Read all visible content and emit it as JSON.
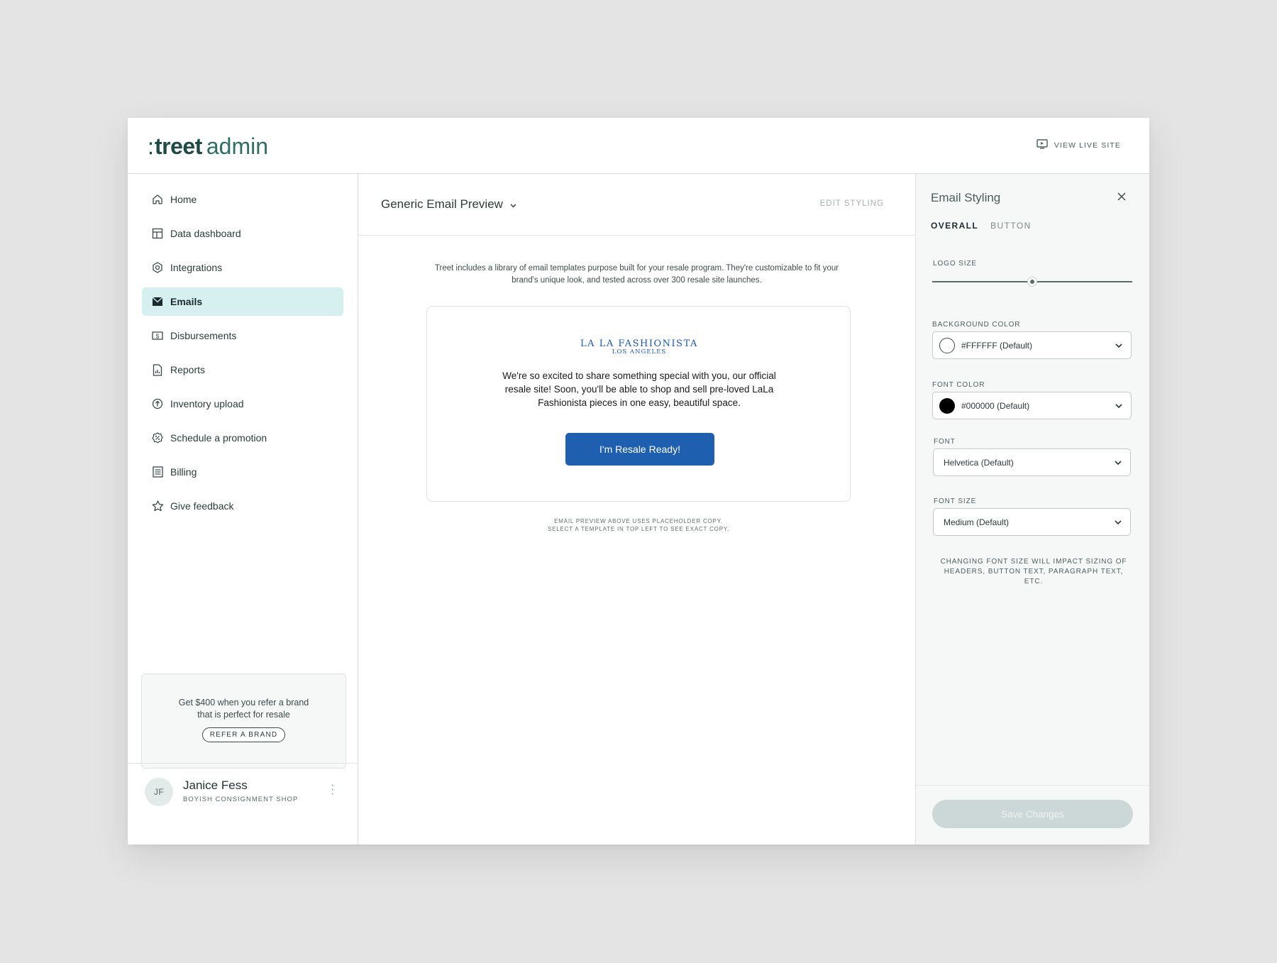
{
  "header": {
    "logo_brand": "treet",
    "logo_suffix": "admin",
    "view_live_label": "VIEW LIVE SITE"
  },
  "sidebar": {
    "items": [
      {
        "label": "Home",
        "icon": "home-icon",
        "active": false
      },
      {
        "label": "Data dashboard",
        "icon": "dashboard-icon",
        "active": false
      },
      {
        "label": "Integrations",
        "icon": "integrations-icon",
        "active": false
      },
      {
        "label": "Emails",
        "icon": "envelope-icon",
        "active": true
      },
      {
        "label": "Disbursements",
        "icon": "dollar-icon",
        "active": false
      },
      {
        "label": "Reports",
        "icon": "report-icon",
        "active": false
      },
      {
        "label": "Inventory upload",
        "icon": "upload-icon",
        "active": false
      },
      {
        "label": "Schedule a promotion",
        "icon": "percent-badge-icon",
        "active": false
      },
      {
        "label": "Billing",
        "icon": "billing-icon",
        "active": false
      },
      {
        "label": "Give feedback",
        "icon": "star-icon",
        "active": false
      }
    ],
    "refer": {
      "text": "Get $400 when you refer a brand that is perfect for resale",
      "button": "REFER A BRAND"
    },
    "user": {
      "initials": "JF",
      "name": "Janice Fess",
      "shop": "BOYISH CONSIGNMENT SHOP"
    }
  },
  "main": {
    "preview_title": "Generic Email Preview",
    "edit_styling": "EDIT STYLING",
    "intro": "Treet includes a library of email templates purpose built for your resale program. They're customizable to fit your brand's unique look, and tested across over 300 resale site launches.",
    "email": {
      "brand_name": "LA LA FASHIONISTA",
      "brand_city": "LOS ANGELES",
      "body": "We're so excited to share something special with you, our official resale site! Soon, you'll be able to shop and sell pre-loved LaLa Fashionista pieces in one easy, beautiful space.",
      "cta": "I'm Resale Ready!"
    },
    "disclaimer_line1": "EMAIL PREVIEW ABOVE USES PLACEHOLDER COPY.",
    "disclaimer_line2": "SELECT A TEMPLATE IN TOP LEFT TO SEE EXACT COPY."
  },
  "panel": {
    "title": "Email Styling",
    "tabs": [
      "OVERALL",
      "BUTTON"
    ],
    "active_tab": "OVERALL",
    "logo_size_label": "LOGO SIZE",
    "logo_size_value": 0.5,
    "background_color_label": "BACKGROUND COLOR",
    "background_color_value": "#FFFFFF (Default)",
    "background_swatch": "#ffffff",
    "font_color_label": "FONT COLOR",
    "font_color_value": "#000000 (Default)",
    "font_swatch": "#000000",
    "font_label": "FONT",
    "font_value": "Helvetica (Default)",
    "font_size_label": "FONT SIZE",
    "font_size_value": "Medium (Default)",
    "note": "CHANGING FONT SIZE WILL IMPACT SIZING OF HEADERS, BUTTON TEXT, PARAGRAPH TEXT, ETC.",
    "save_label": "Save Changes"
  },
  "colors": {
    "accent_active_nav": "#d5f0ef",
    "brand_blue": "#1f5fb0",
    "logo_green": "#1f4a45"
  }
}
